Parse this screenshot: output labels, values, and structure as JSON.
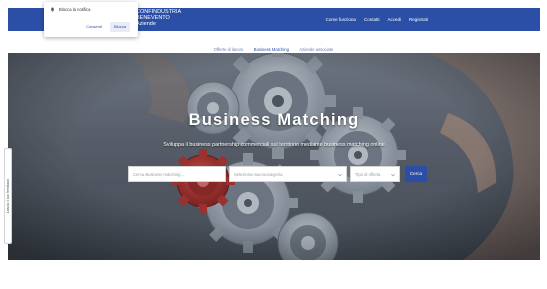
{
  "popup": {
    "message": "Blocca la notifica",
    "cancel_label": "Consenti",
    "allow_label": "Blocca"
  },
  "header": {
    "brand_line1": "CONFINDUSTRIA",
    "brand_line2": "BENEVENTO",
    "brand_line3": "Aziende",
    "nav": [
      "Come funziona",
      "Contatti",
      "Accedi",
      "Registrati"
    ]
  },
  "tabs": [
    "Offerte di lavoro",
    "Business Matching",
    "Aziende associate"
  ],
  "hero": {
    "title": "Business Matching",
    "subtitle": "Sviluppa il business partnership commerciali sul territorio mediante business matching online"
  },
  "search": {
    "query_placeholder": "Cerca Business matching...",
    "category_placeholder": "Seleziona macrocategoria",
    "type_placeholder": "Tipo di offerta",
    "button_label": "Cerca"
  },
  "feedback": {
    "label": "Lascia il tuo feedback"
  },
  "colors": {
    "brand_blue": "#2b4fa6",
    "hero_gray": "#5f6570",
    "gear_red": "#c8302b"
  },
  "icons": [
    "bell-icon",
    "chevron-down-icon",
    "gear-icon"
  ]
}
